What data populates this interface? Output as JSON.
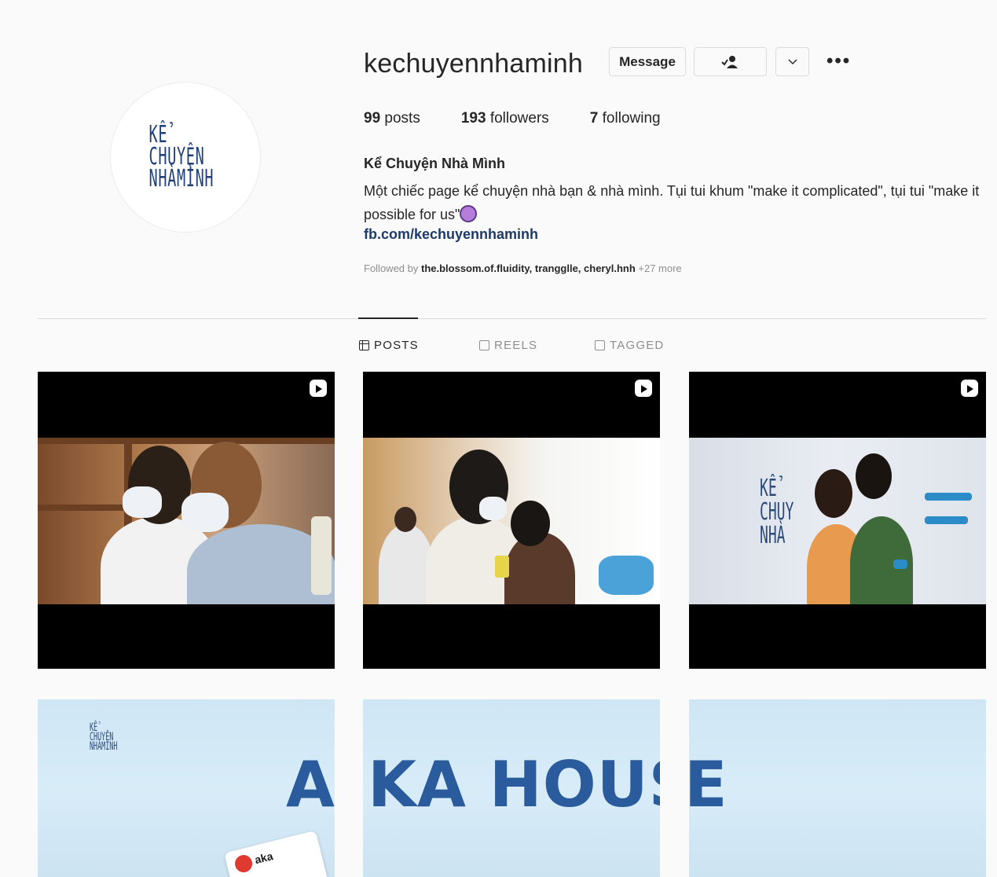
{
  "profile": {
    "username": "kechuyennhaminh",
    "avatar_logo_lines": [
      "KỂ",
      "CHUYỆN",
      "NHÀMÌNH"
    ],
    "buttons": {
      "message": "Message",
      "follow_icon": "following-person-check-icon",
      "dropdown_icon": "chevron-down-icon",
      "more_icon": "more-horizontal-icon"
    },
    "stats": {
      "posts_count": "99",
      "posts_label": " posts",
      "followers_count": "193",
      "followers_label": " followers",
      "following_count": "7",
      "following_label": " following"
    },
    "full_name": "Kể Chuyện Nhà Mình",
    "bio": "Một chiếc page kể chuyện nhà bạn & nhà mình. Tụi tui khum \"make it complicated\", tụi tui \"make it possible for us\"",
    "bio_emoji": "woman-emoji",
    "link": "fb.com/kechuyennhaminh",
    "followed_by_prefix": "Followed by ",
    "followed_by_users": "the.blossom.of.fluidity, trangglle, cheryl.hnh",
    "followed_by_more": " +27 more"
  },
  "tabs": [
    {
      "label": "POSTS",
      "icon": "grid-icon",
      "active": true
    },
    {
      "label": "REELS",
      "icon": "reels-icon",
      "active": false
    },
    {
      "label": "TAGGED",
      "icon": "tagged-icon",
      "active": false
    }
  ],
  "posts": [
    {
      "type": "reel",
      "icon": "reel-icon",
      "description_visual": "two masked young men"
    },
    {
      "type": "reel",
      "icon": "reel-icon",
      "description_visual": "people writing on wall"
    },
    {
      "type": "reel",
      "icon": "reel-icon",
      "description_visual": "couple standing by wall"
    }
  ],
  "banner": {
    "logo_lines": [
      "KỂ",
      "CHUYỆN",
      "NHÀMÌNH"
    ],
    "text_part1": "A",
    "text_part2": "KA HOUS",
    "text_part3": "E",
    "sticker_text": "aka"
  },
  "colors": {
    "link": "#1d3a6b",
    "brand_blue": "#2a5c9d",
    "border": "#dbdbdb",
    "muted": "#8e8e8e"
  }
}
